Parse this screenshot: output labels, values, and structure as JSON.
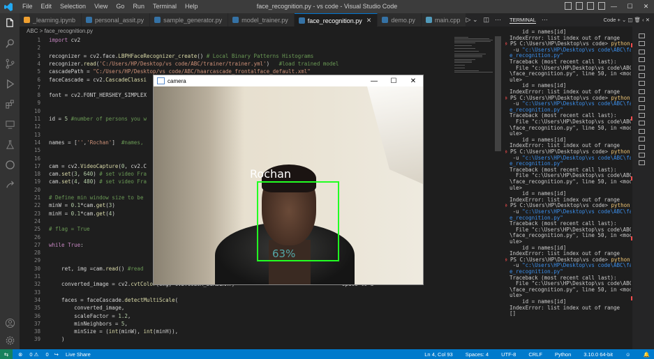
{
  "window": {
    "title": "face_recognition.py - vs code - Visual Studio Code"
  },
  "menu": [
    "File",
    "Edit",
    "Selection",
    "View",
    "Go",
    "Run",
    "Terminal",
    "Help"
  ],
  "tabs": [
    {
      "label": "_learning.ipynb",
      "color": "#f0a030"
    },
    {
      "label": "personal_assit.py",
      "color": "#3572a5"
    },
    {
      "label": "sample_generator.py",
      "color": "#3572a5"
    },
    {
      "label": "model_trainer.py",
      "color": "#3572a5"
    },
    {
      "label": "face_recognition.py",
      "color": "#3572a5",
      "active": true
    },
    {
      "label": "demo.py",
      "color": "#3572a5"
    },
    {
      "label": "main.cpp",
      "color": "#519aba"
    }
  ],
  "breadcrumb": "ABC  >  face_recognition.py",
  "editor": {
    "line_numbers": [
      "1",
      "2",
      "3",
      "4",
      "5",
      "6",
      "7",
      "8",
      "9",
      "10",
      "11",
      "12",
      "13",
      "14",
      "15",
      "16",
      "17",
      "18",
      "19",
      "20",
      "21",
      "22",
      "23",
      "24",
      "25",
      "26",
      "27",
      "28",
      "29",
      "30",
      "31",
      "32",
      "33",
      "34",
      "35",
      "36",
      "37"
    ],
    "lines": [
      "import cv2",
      "",
      "recognizer = cv2.face.LBPHFaceRecognizer_create() # Local Binary Patterns Histograms",
      "recognizer.read('C:/Users/HP/Desktop/vs code/ABC/trainer/trainer.yml')   #load trained model",
      "cascadePath = \"C:/Users/HP/Desktop/vs code/ABC/haarcascade_frontalface_default.xml\"",
      "faceCascade = cv2.CascadeClassi",
      "",
      "font = cv2.FONT_HERSHEY_SIMPLEX",
      "",
      "",
      "id = 5 #number of persons you w",
      "",
      "",
      "names = ['','Rochan']  #names,",
      "",
      "",
      "cam = cv2.VideoCapture(0, cv2.C",
      "cam.set(3, 640) # set video Fra",
      "cam.set(4, 480) # set video Fra",
      "",
      "# Define min window size to be",
      "minW = 0.1*cam.get(3)",
      "minH = 0.1*cam.get(4)",
      "",
      "# flag = True",
      "",
      "while True:",
      "",
      "",
      "    ret, img =cam.read() #read",
      "",
      "    converted_image = cv2.cvtColor(img, cv2.COLOR_BGR2GRAY)                                  space to a",
      "",
      "    faces = faceCascade.detectMultiScale(",
      "        converted_image,",
      "        scaleFactor = 1.2,",
      "        minNeighbors = 5,",
      "        minSize = (int(minW), int(minH)),",
      "    )"
    ]
  },
  "camera_window": {
    "title": "camera",
    "recognized_name": "Rochan",
    "confidence": "63%"
  },
  "terminal": {
    "panel_title": "TERMINAL",
    "shell_label": "Code",
    "lines": [
      {
        "text": "    id = names[id]"
      },
      {
        "text": "IndexError: list index out of range"
      },
      {
        "prompt": "PS C:\\Users\\HP\\Desktop\\vs code> ",
        "cmd": "python"
      },
      {
        "text": " -u ",
        "path": "\"c:\\Users\\HP\\Desktop\\vs code\\ABC\\fac"
      },
      {
        "path": "e_recognition.py\""
      },
      {
        "text": "Traceback (most recent call last):"
      },
      {
        "text": "  File \"c:\\Users\\HP\\Desktop\\vs code\\ABC"
      },
      {
        "text": "\\face_recognition.py\", line 50, in <mod"
      },
      {
        "text": "ule>"
      },
      {
        "text": "    id = names[id]"
      },
      {
        "text": "IndexError: list index out of range"
      },
      {
        "prompt": "PS C:\\Users\\HP\\Desktop\\vs code> ",
        "cmd": "python"
      },
      {
        "text": " -u ",
        "path": "\"c:\\Users\\HP\\Desktop\\vs code\\ABC\\fac"
      },
      {
        "path": "e_recognition.py\""
      },
      {
        "text": "Traceback (most recent call last):"
      },
      {
        "text": "  File \"c:\\Users\\HP\\Desktop\\vs code\\ABC"
      },
      {
        "text": "\\face_recognition.py\", line 50, in <mod"
      },
      {
        "text": "ule>"
      },
      {
        "text": "    id = names[id]"
      },
      {
        "text": "IndexError: list index out of range"
      },
      {
        "prompt": "PS C:\\Users\\HP\\Desktop\\vs code> ",
        "cmd": "python"
      },
      {
        "text": " -u ",
        "path": "\"c:\\Users\\HP\\Desktop\\vs code\\ABC\\fac"
      },
      {
        "path": "e_recognition.py\""
      },
      {
        "text": "Traceback (most recent call last):"
      },
      {
        "text": "  File \"c:\\Users\\HP\\Desktop\\vs code\\ABC"
      },
      {
        "text": "\\face_recognition.py\", line 50, in <mod"
      },
      {
        "text": "ule>"
      },
      {
        "text": "    id = names[id]"
      },
      {
        "text": "IndexError: list index out of range"
      },
      {
        "prompt": "PS C:\\Users\\HP\\Desktop\\vs code> ",
        "cmd": "python"
      },
      {
        "text": " -u ",
        "path": "\"c:\\Users\\HP\\Desktop\\vs code\\ABC\\fac"
      },
      {
        "path": "e_recognition.py\""
      },
      {
        "text": "Traceback (most recent call last):"
      },
      {
        "text": "  File \"c:\\Users\\HP\\Desktop\\vs code\\ABC"
      },
      {
        "text": "\\face_recognition.py\", line 50, in <mod"
      },
      {
        "text": "ule>"
      },
      {
        "text": "    id = names[id]"
      },
      {
        "text": "IndexError: list index out of range"
      },
      {
        "prompt": "PS C:\\Users\\HP\\Desktop\\vs code> ",
        "cmd": "python"
      },
      {
        "text": " -u ",
        "path": "\"c:\\Users\\HP\\Desktop\\vs code\\ABC\\fac"
      },
      {
        "path": "e_recognition.py\""
      },
      {
        "text": "Traceback (most recent call last):"
      },
      {
        "text": "  File \"c:\\Users\\HP\\Desktop\\vs code\\ABC"
      },
      {
        "text": "\\face_recognition.py\", line 50, in <mod"
      },
      {
        "text": "ule>"
      },
      {
        "text": "    id = names[id]"
      },
      {
        "text": "IndexError: list index out of range"
      },
      {
        "text": "[]"
      }
    ]
  },
  "statusbar": {
    "errors": "0",
    "warnings": "0",
    "live_share": "Live Share",
    "position": "Ln 4, Col 93",
    "spaces": "Spaces: 4",
    "encoding": "UTF-8",
    "eol": "CRLF",
    "language": "Python",
    "interpreter": "3.10.0 64-bit"
  }
}
